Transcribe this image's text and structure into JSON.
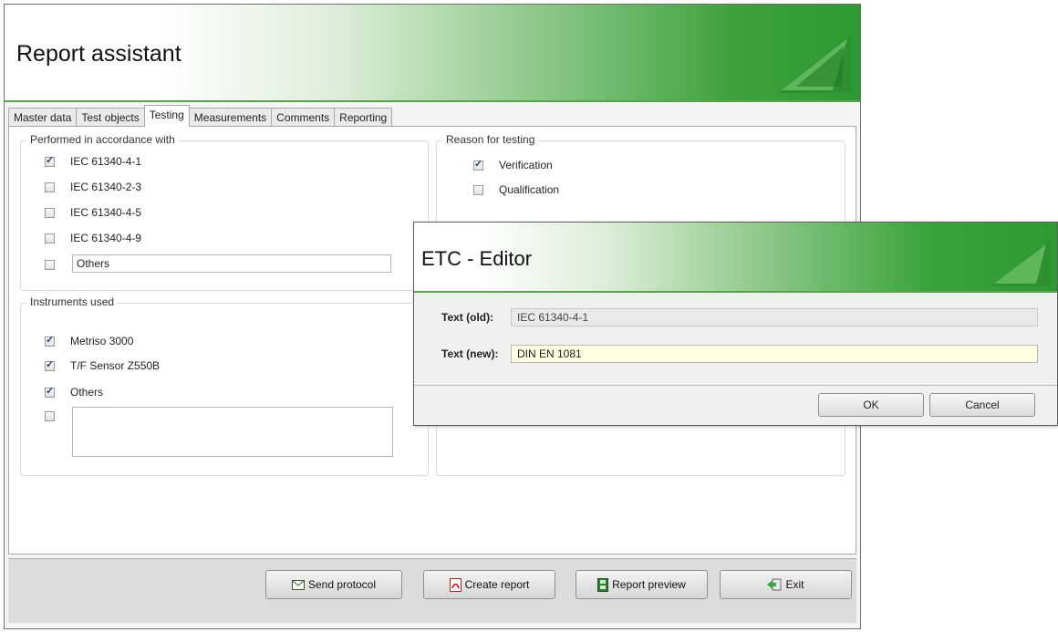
{
  "window": {
    "title": "Report assistant"
  },
  "tabs": [
    "Master data",
    "Test objects",
    "Testing",
    "Measurements",
    "Comments",
    "Reporting"
  ],
  "active_tab": "Testing",
  "standards": {
    "title": "Performed in accordance with",
    "items": [
      {
        "label": "IEC 61340-4-1",
        "checked": true
      },
      {
        "label": "IEC 61340-2-3",
        "checked": false
      },
      {
        "label": "IEC 61340-4-5",
        "checked": false
      },
      {
        "label": "IEC 61340-4-9",
        "checked": false
      }
    ],
    "others_value": "Others"
  },
  "reason": {
    "title": "Reason for testing",
    "items": [
      {
        "label": "Verification",
        "checked": true
      },
      {
        "label": "Qualification",
        "checked": false
      }
    ]
  },
  "instruments": {
    "title": "Instruments used",
    "items": [
      {
        "label": "Metriso 3000",
        "checked": true
      },
      {
        "label": "T/F Sensor Z550B",
        "checked": true
      },
      {
        "label": "Others",
        "checked": true
      }
    ],
    "extra_checked": false,
    "extra_text": ""
  },
  "buttons": {
    "send_protocol": "Send protocol",
    "create_report": "Create report",
    "report_preview": "Report preview",
    "exit": "Exit"
  },
  "editor": {
    "title": "ETC - Editor",
    "old_label": "Text (old):",
    "old_value": "IEC 61340-4-1",
    "new_label": "Text (new):",
    "new_value": "DIN EN 1081",
    "ok": "OK",
    "cancel": "Cancel"
  },
  "colors": {
    "header_green": "#2d9a32",
    "input_highlight": "#ffffe1"
  }
}
